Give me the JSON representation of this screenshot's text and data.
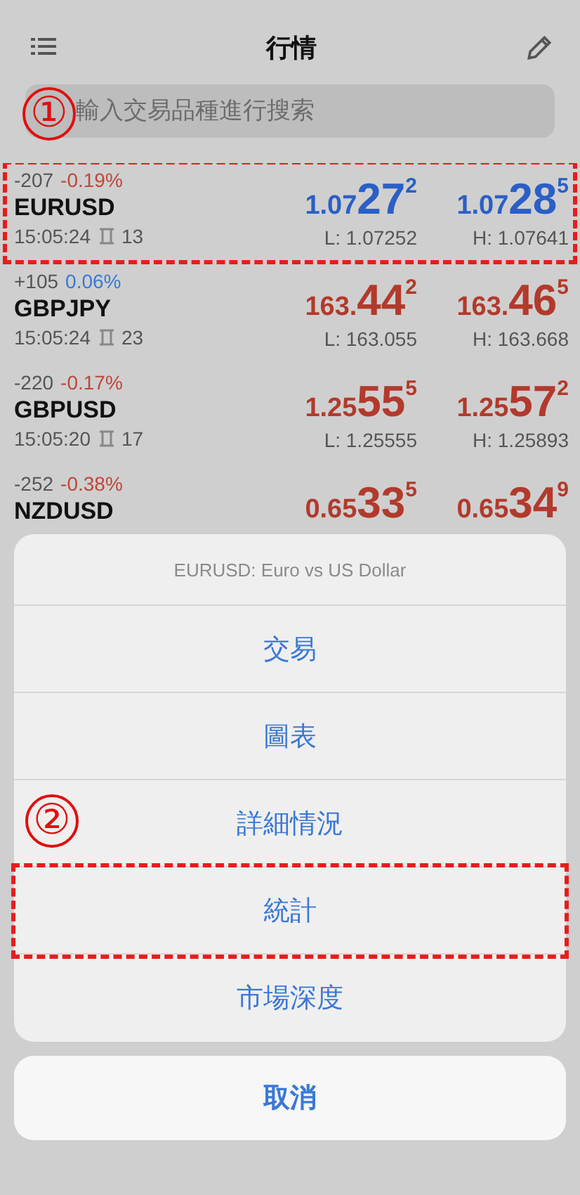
{
  "header": {
    "title": "行情"
  },
  "search": {
    "placeholder": "輸入交易品種進行搜索",
    "marker": "①"
  },
  "quotes": [
    {
      "change": "-207",
      "change_pct": "-0.19%",
      "change_rising": false,
      "symbol": "EURUSD",
      "time": "15:05:24",
      "spread": "13",
      "price_rising": true,
      "outlined": true,
      "bid": {
        "prefix": "1.07",
        "big": "27",
        "sup": "2"
      },
      "ask": {
        "prefix": "1.07",
        "big": "28",
        "sup": "5"
      },
      "low": "L: 1.07252",
      "high": "H: 1.07641"
    },
    {
      "change": "+105",
      "change_pct": "0.06%",
      "change_rising": true,
      "symbol": "GBPJPY",
      "time": "15:05:24",
      "spread": "23",
      "price_rising": false,
      "outlined": false,
      "bid": {
        "prefix": "163.",
        "big": "44",
        "sup": "2"
      },
      "ask": {
        "prefix": "163.",
        "big": "46",
        "sup": "5"
      },
      "low": "L: 163.055",
      "high": "H: 163.668"
    },
    {
      "change": "-220",
      "change_pct": "-0.17%",
      "change_rising": false,
      "symbol": "GBPUSD",
      "time": "15:05:20",
      "spread": "17",
      "price_rising": false,
      "outlined": false,
      "bid": {
        "prefix": "1.25",
        "big": "55",
        "sup": "5"
      },
      "ask": {
        "prefix": "1.25",
        "big": "57",
        "sup": "2"
      },
      "low": "L: 1.25555",
      "high": "H: 1.25893"
    },
    {
      "change": "-252",
      "change_pct": "-0.38%",
      "change_rising": false,
      "symbol": "NZDUSD",
      "price_rising": false,
      "outlined": false,
      "bid": {
        "prefix": "0.65",
        "big": "33",
        "sup": "5"
      },
      "ask": {
        "prefix": "0.65",
        "big": "34",
        "sup": "9"
      }
    }
  ],
  "sheet": {
    "title": "EURUSD: Euro vs US Dollar",
    "actions": [
      {
        "label": "交易",
        "outlined": false
      },
      {
        "label": "圖表",
        "outlined": false
      },
      {
        "label": "詳細情況",
        "outlined": false,
        "marker": "②"
      },
      {
        "label": "統計",
        "outlined": true
      },
      {
        "label": "市場深度",
        "outlined": false
      }
    ],
    "cancel": "取消"
  }
}
